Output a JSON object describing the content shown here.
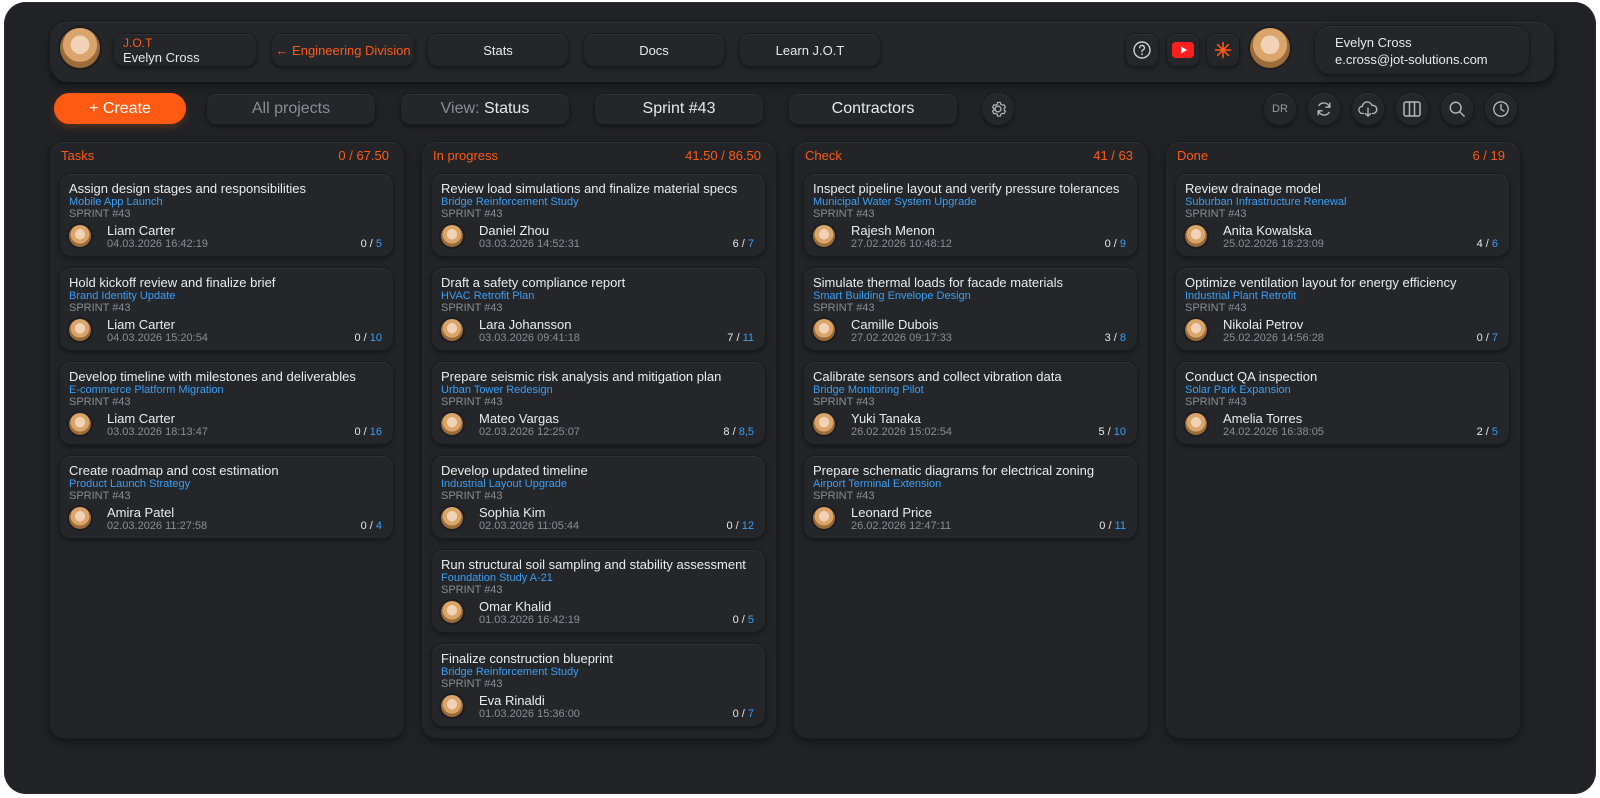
{
  "colors": {
    "accent": "#ff5a14",
    "link": "#3a9ff5",
    "background": "#212225"
  },
  "header": {
    "app_name": "J.O.T",
    "current_user": "Evelyn Cross",
    "division_link": "← Engineering Division",
    "nav": [
      "Stats",
      "Docs",
      "Learn J.O.T"
    ],
    "icons": [
      "help-icon",
      "youtube-icon",
      "sparkle-icon"
    ],
    "profile": {
      "name": "Evelyn Cross",
      "email": "e.cross@jot-solutions.com"
    }
  },
  "toolbar": {
    "create_label": "+ Create",
    "projects_label": "All projects",
    "view_prefix": "View:",
    "view_value": "Status",
    "sprint_label": "Sprint #43",
    "contractors_label": "Contractors",
    "settings_icon": "gear-icon",
    "initials": "DR",
    "right_icons": [
      "refresh-icon",
      "cloud-download-icon",
      "columns-icon",
      "search-icon",
      "clock-icon"
    ]
  },
  "board": {
    "columns": [
      {
        "title": "Tasks",
        "summary": "0 / 67.50",
        "cards": [
          {
            "title": "Assign design stages and responsibilities",
            "project": "Mobile App Launch",
            "sprint": "SPRINT #43",
            "assignee": "Liam Carter",
            "date": "04.03.2026 16:42:19",
            "done": "0",
            "total": "5"
          },
          {
            "title": "Hold kickoff review and finalize brief",
            "project": "Brand Identity Update",
            "sprint": "SPRINT #43",
            "assignee": "Liam Carter",
            "date": "04.03.2026 15:20:54",
            "done": "0",
            "total": "10"
          },
          {
            "title": "Develop timeline with milestones and deliverables",
            "project": "E-commerce Platform Migration",
            "sprint": "SPRINT #43",
            "assignee": "Liam Carter",
            "date": "03.03.2026 18:13:47",
            "done": "0",
            "total": "16"
          },
          {
            "title": "Create roadmap and cost estimation",
            "project": "Product Launch Strategy",
            "sprint": "SPRINT #43",
            "assignee": "Amira Patel",
            "date": "02.03.2026 11:27:58",
            "done": "0",
            "total": "4"
          }
        ]
      },
      {
        "title": "In progress",
        "summary": "41.50 / 86.50",
        "cards": [
          {
            "title": "Review load simulations and finalize material specs",
            "project": "Bridge Reinforcement Study",
            "sprint": "SPRINT #43",
            "assignee": "Daniel Zhou",
            "date": "03.03.2026 14:52:31",
            "done": "6",
            "total": "7"
          },
          {
            "title": "Draft a safety compliance report",
            "project": "HVAC Retrofit Plan",
            "sprint": "SPRINT #43",
            "assignee": "Lara Johansson",
            "date": "03.03.2026 09:41:18",
            "done": "7",
            "total": "11"
          },
          {
            "title": "Prepare seismic risk analysis and mitigation plan",
            "project": "Urban Tower Redesign",
            "sprint": "SPRINT #43",
            "assignee": "Mateo Vargas",
            "date": "02.03.2026 12:25:07",
            "done": "8",
            "total": "8,5"
          },
          {
            "title": "Develop updated timeline",
            "project": "Industrial Layout Upgrade",
            "sprint": "SPRINT #43",
            "assignee": "Sophia Kim",
            "date": "02.03.2026 11:05:44",
            "done": "0",
            "total": "12"
          },
          {
            "title": "Run structural soil sampling and stability assessment",
            "project": "Foundation Study A-21",
            "sprint": "SPRINT #43",
            "assignee": "Omar Khalid",
            "date": "01.03.2026 16:42:19",
            "done": "0",
            "total": "5"
          },
          {
            "title": "Finalize construction blueprint",
            "project": "Bridge Reinforcement Study",
            "sprint": "SPRINT #43",
            "assignee": "Eva Rinaldi",
            "date": "01.03.2026 15:36:00",
            "done": "0",
            "total": "7"
          }
        ]
      },
      {
        "title": "Check",
        "summary": "41 / 63",
        "cards": [
          {
            "title": "Inspect pipeline layout and verify pressure tolerances",
            "project": "Municipal Water System Upgrade",
            "sprint": "SPRINT #43",
            "assignee": "Rajesh Menon",
            "date": "27.02.2026 10:48:12",
            "done": "0",
            "total": "9"
          },
          {
            "title": "Simulate thermal loads for facade materials",
            "project": "Smart Building Envelope Design",
            "sprint": "SPRINT #43",
            "assignee": "Camille Dubois",
            "date": "27.02.2026 09:17:33",
            "done": "3",
            "total": "8"
          },
          {
            "title": "Calibrate sensors and collect vibration data",
            "project": "Bridge Monitoring Pilot",
            "sprint": "SPRINT #43",
            "assignee": "Yuki Tanaka",
            "date": "26.02.2026 15:02:54",
            "done": "5",
            "total": "10"
          },
          {
            "title": "Prepare schematic diagrams for electrical zoning",
            "project": "Airport Terminal Extension",
            "sprint": "SPRINT #43",
            "assignee": "Leonard Price",
            "date": "26.02.2026 12:47:11",
            "done": "0",
            "total": "11"
          }
        ]
      },
      {
        "title": "Done",
        "summary": "6 / 19",
        "cards": [
          {
            "title": "Review drainage model",
            "project": "Suburban Infrastructure Renewal",
            "sprint": "SPRINT #43",
            "assignee": "Anita Kowalska",
            "date": "25.02.2026 18:23:09",
            "done": "4",
            "total": "6"
          },
          {
            "title": "Optimize ventilation layout for energy efficiency",
            "project": "Industrial Plant Retrofit",
            "sprint": "SPRINT #43",
            "assignee": "Nikolai Petrov",
            "date": "25.02.2026 14:56:28",
            "done": "0",
            "total": "7"
          },
          {
            "title": "Conduct QA inspection",
            "project": "Solar Park Expansion",
            "sprint": "SPRINT #43",
            "assignee": "Amelia Torres",
            "date": "24.02.2026 16:38:05",
            "done": "2",
            "total": "5"
          }
        ]
      }
    ]
  }
}
